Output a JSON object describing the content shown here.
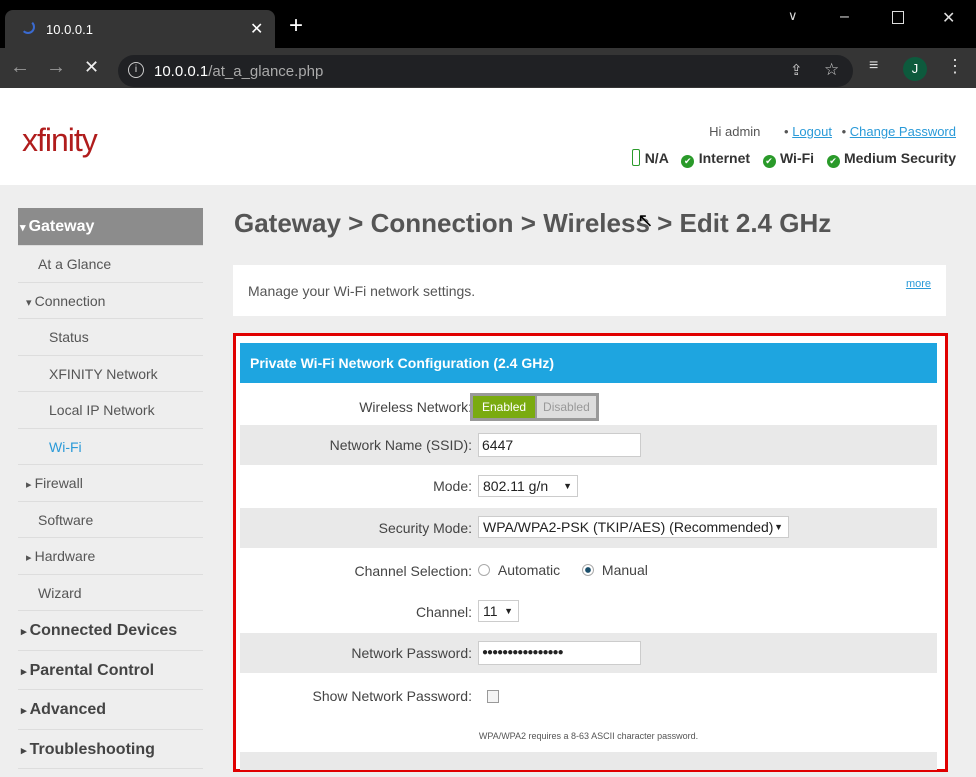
{
  "browser": {
    "tab_title": "10.0.0.1",
    "url_host": "10.0.0.1",
    "url_path": "/at_a_glance.php",
    "profile_initial": "J"
  },
  "header": {
    "logo": "xfinity",
    "greeting": "Hi admin",
    "logout": "Logout",
    "change_password": "Change Password",
    "status": [
      {
        "icon": "battery-icon",
        "label": "N/A"
      },
      {
        "icon": "check-icon",
        "label": "Internet"
      },
      {
        "icon": "check-icon",
        "label": "Wi-Fi"
      },
      {
        "icon": "check-icon",
        "label": "Medium Security"
      }
    ]
  },
  "sidebar": {
    "items": [
      {
        "label": "Gateway",
        "level": 0,
        "active": true,
        "arrow": "▾"
      },
      {
        "label": "At a Glance",
        "level": 1
      },
      {
        "label": "Connection",
        "level": 1,
        "arrow": "▾"
      },
      {
        "label": "Status",
        "level": 2
      },
      {
        "label": "XFINITY Network",
        "level": 2
      },
      {
        "label": "Local IP Network",
        "level": 2
      },
      {
        "label": "Wi-Fi",
        "level": 2,
        "selected": true
      },
      {
        "label": "Firewall",
        "level": 1,
        "arrow": "▸"
      },
      {
        "label": "Software",
        "level": 1
      },
      {
        "label": "Hardware",
        "level": 1,
        "arrow": "▸"
      },
      {
        "label": "Wizard",
        "level": 1
      },
      {
        "label": "Connected Devices",
        "level": 0,
        "arrow": "▸"
      },
      {
        "label": "Parental Control",
        "level": 0,
        "arrow": "▸"
      },
      {
        "label": "Advanced",
        "level": 0,
        "arrow": "▸"
      },
      {
        "label": "Troubleshooting",
        "level": 0,
        "arrow": "▸"
      }
    ]
  },
  "main": {
    "title": "Gateway > Connection > Wireless > Edit 2.4 GHz",
    "description": "Manage your Wi-Fi network settings.",
    "more": "more",
    "section_title": "Private Wi-Fi Network Configuration (2.4 GHz)",
    "wireless_label": "Wireless Network:",
    "enabled": "Enabled",
    "disabled": "Disabled",
    "ssid_label": "Network Name (SSID):",
    "ssid_value": "6447",
    "mode_label": "Mode:",
    "mode_value": "802.11 g/n",
    "security_label": "Security Mode:",
    "security_value": "WPA/WPA2-PSK (TKIP/AES) (Recommended)",
    "channel_sel_label": "Channel Selection:",
    "automatic": "Automatic",
    "manual": "Manual",
    "channel_selection": "Manual",
    "channel_label": "Channel:",
    "channel_value": "11",
    "password_label": "Network Password:",
    "password_value": "●●●●●●●●●●●●●●●●",
    "show_password_label": "Show Network Password:",
    "show_password": false,
    "note": "WPA/WPA2 requires a 8-63 ASCII character password."
  },
  "colors": {
    "accent_blue": "#1ea5e0",
    "enabled_green": "#7aab10",
    "highlight_red": "#e00000",
    "logo_red": "#b01c1c"
  }
}
